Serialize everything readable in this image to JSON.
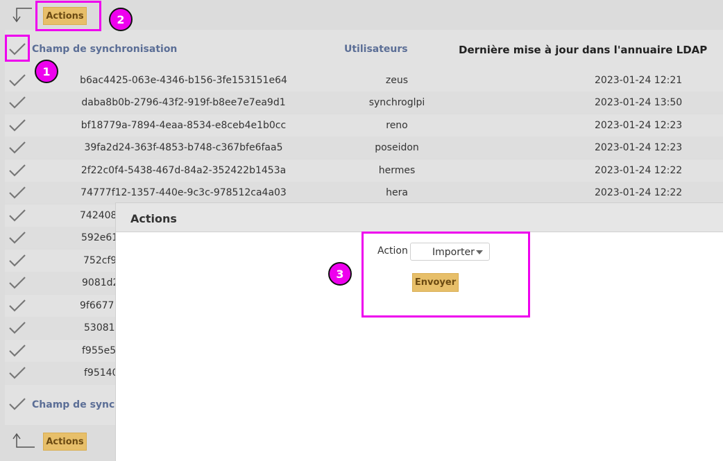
{
  "toolbar_top": {
    "actions_label": "Actions"
  },
  "toolbar_bottom": {
    "actions_label": "Actions"
  },
  "table": {
    "headers": {
      "sync_field": "Champ de synchronisation",
      "users": "Utilisateurs",
      "last_update": "Dernière mise à jour dans l'annuaire LDAP"
    },
    "rows": [
      {
        "id": "b6ac4425-063e-4346-b156-3fe153151e64",
        "user": "zeus",
        "date": "2023-01-24 12:21"
      },
      {
        "id": "daba8b0b-2796-43f2-919f-b8ee7e7ea9d1",
        "user": "synchroglpi",
        "date": "2023-01-24 13:50"
      },
      {
        "id": "bf18779a-7894-4eaa-8534-e8ceb4e1b0cc",
        "user": "reno",
        "date": "2023-01-24 12:23"
      },
      {
        "id": "39fa2d24-363f-4853-b748-c367bfe6faa5",
        "user": "poseidon",
        "date": "2023-01-24 12:23"
      },
      {
        "id": "2f22c0f4-5438-467d-84a2-352422b1453a",
        "user": "hermes",
        "date": "2023-01-24 12:22"
      },
      {
        "id": "74777f12-1357-440e-9c3c-978512ca4a03",
        "user": "hera",
        "date": "2023-01-24 12:22"
      },
      {
        "id": "742408"
      },
      {
        "id": "592e61"
      },
      {
        "id": "752cf9"
      },
      {
        "id": "9081d2"
      },
      {
        "id": "9f6677"
      },
      {
        "id": "53081"
      },
      {
        "id": "f955e5"
      },
      {
        "id": "f95140"
      }
    ],
    "footer_sync_field": "Champ de synch"
  },
  "modal": {
    "title": "Actions",
    "action_label": "Action",
    "action_selected": "Importer",
    "submit_label": "Envoyer"
  },
  "annotations": {
    "badge_1": "1",
    "badge_2": "2",
    "badge_3": "3"
  },
  "colors": {
    "accent": "#e7bf6a",
    "link": "#5b6e96",
    "highlight": "#ee00ee"
  }
}
